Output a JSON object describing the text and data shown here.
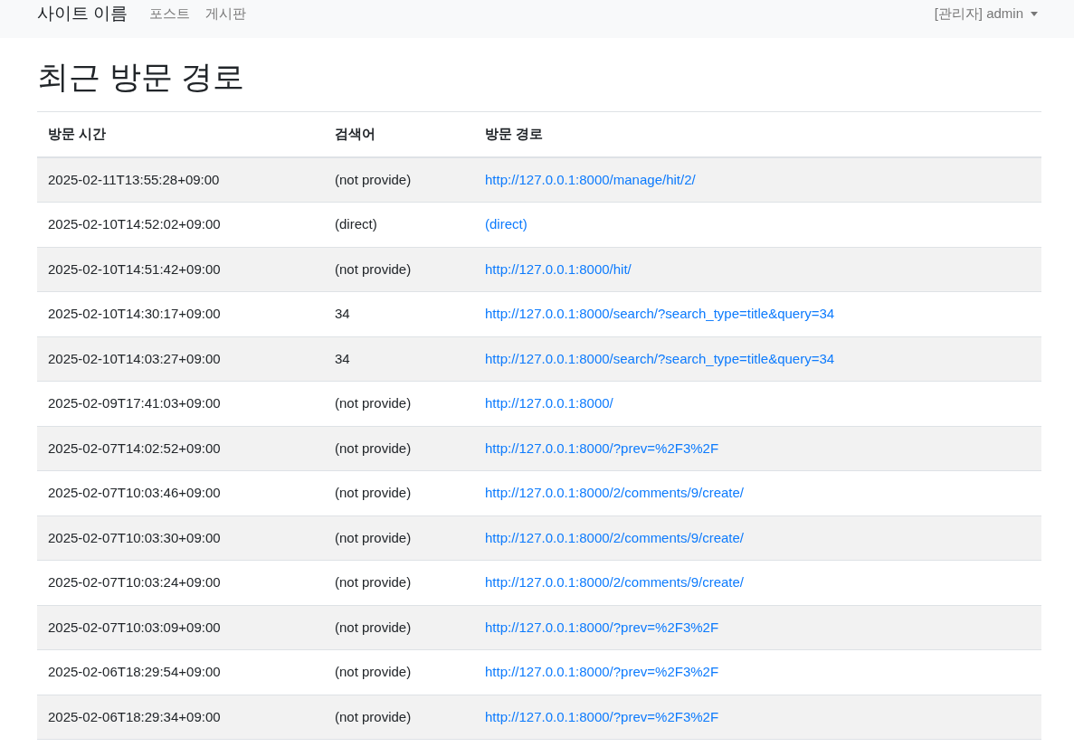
{
  "navbar": {
    "brand": "사이트 이름",
    "links": [
      {
        "label": "포스트"
      },
      {
        "label": "게시판"
      }
    ],
    "user_menu": "[관리자] admin"
  },
  "page_title": "최근 방문 경로",
  "table": {
    "columns": [
      "방문 시간",
      "검색어",
      "방문 경로"
    ],
    "rows": [
      {
        "time": "2025-02-11T13:55:28+09:00",
        "keyword": "(not provide)",
        "path": "http://127.0.0.1:8000/manage/hit/2/"
      },
      {
        "time": "2025-02-10T14:52:02+09:00",
        "keyword": "(direct)",
        "path": "(direct)"
      },
      {
        "time": "2025-02-10T14:51:42+09:00",
        "keyword": "(not provide)",
        "path": "http://127.0.0.1:8000/hit/"
      },
      {
        "time": "2025-02-10T14:30:17+09:00",
        "keyword": "34",
        "path": "http://127.0.0.1:8000/search/?search_type=title&query=34"
      },
      {
        "time": "2025-02-10T14:03:27+09:00",
        "keyword": "34",
        "path": "http://127.0.0.1:8000/search/?search_type=title&query=34"
      },
      {
        "time": "2025-02-09T17:41:03+09:00",
        "keyword": "(not provide)",
        "path": "http://127.0.0.1:8000/"
      },
      {
        "time": "2025-02-07T14:02:52+09:00",
        "keyword": "(not provide)",
        "path": "http://127.0.0.1:8000/?prev=%2F3%2F"
      },
      {
        "time": "2025-02-07T10:03:46+09:00",
        "keyword": "(not provide)",
        "path": "http://127.0.0.1:8000/2/comments/9/create/"
      },
      {
        "time": "2025-02-07T10:03:30+09:00",
        "keyword": "(not provide)",
        "path": "http://127.0.0.1:8000/2/comments/9/create/"
      },
      {
        "time": "2025-02-07T10:03:24+09:00",
        "keyword": "(not provide)",
        "path": "http://127.0.0.1:8000/2/comments/9/create/"
      },
      {
        "time": "2025-02-07T10:03:09+09:00",
        "keyword": "(not provide)",
        "path": "http://127.0.0.1:8000/?prev=%2F3%2F"
      },
      {
        "time": "2025-02-06T18:29:54+09:00",
        "keyword": "(not provide)",
        "path": "http://127.0.0.1:8000/?prev=%2F3%2F"
      },
      {
        "time": "2025-02-06T18:29:34+09:00",
        "keyword": "(not provide)",
        "path": "http://127.0.0.1:8000/?prev=%2F3%2F"
      }
    ]
  }
}
